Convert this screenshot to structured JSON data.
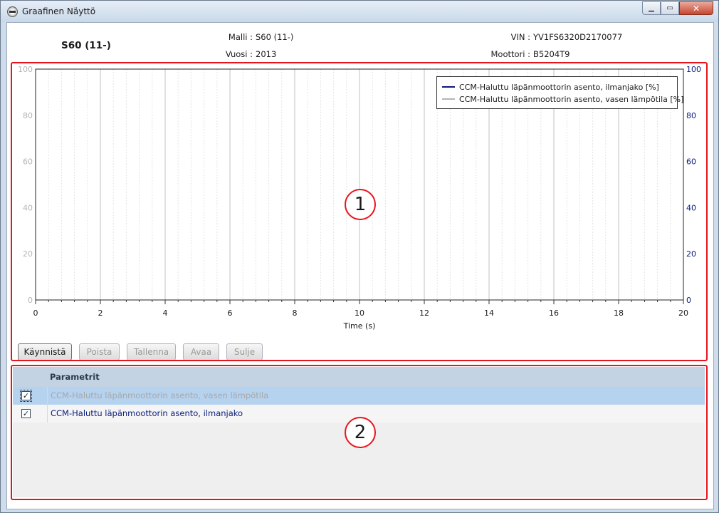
{
  "window": {
    "title": "Graafinen Näyttö"
  },
  "header": {
    "vehicle_name": "S60 (11-)",
    "model_label": "Malli :",
    "model_value": "S60 (11-)",
    "year_label": "Vuosi :",
    "year_value": "2013",
    "vin_label": "VIN :",
    "vin_value": "YV1FS6320D2170077",
    "engine_label": "Moottori :",
    "engine_value": "B5204T9"
  },
  "chart_data": {
    "type": "line",
    "xlabel": "Time (s)",
    "xlim": [
      0,
      20
    ],
    "ylim": [
      0,
      100
    ],
    "y2lim": [
      0,
      100
    ],
    "x_ticks": [
      "0",
      "2",
      "4",
      "6",
      "8",
      "10",
      "12",
      "14",
      "16",
      "18",
      "20"
    ],
    "y_ticks": [
      "0",
      "20",
      "40",
      "60",
      "80",
      "100"
    ],
    "grid": true,
    "legend_position": "top-right",
    "series": [
      {
        "name": "CCM-Haluttu läpänmoottorin asento, ilmanjako [%]",
        "color": "#0a1a7a",
        "axis": "right",
        "values": []
      },
      {
        "name": "CCM-Haluttu läpänmoottorin asento, vasen lämpötila [%]",
        "color": "#b4b4b4",
        "axis": "left",
        "values": []
      }
    ]
  },
  "toolbar": {
    "start": "Käynnistä",
    "remove": "Poista",
    "save": "Tallenna",
    "open": "Avaa",
    "close": "Sulje"
  },
  "params": {
    "header": "Parametrit",
    "rows": [
      {
        "label": "CCM-Haluttu läpänmoottorin asento, vasen lämpötila",
        "checked": "✓",
        "color": "#a8a8a8"
      },
      {
        "label": "CCM-Haluttu läpänmoottorin asento, ilmanjako",
        "checked": "✓",
        "color": "#0a1a7a"
      }
    ]
  },
  "callouts": {
    "chart": "1",
    "params": "2"
  },
  "colors": {
    "frame": "#e8141c",
    "axis_left": "#b4b4b4",
    "axis_right": "#0a1a7a"
  }
}
